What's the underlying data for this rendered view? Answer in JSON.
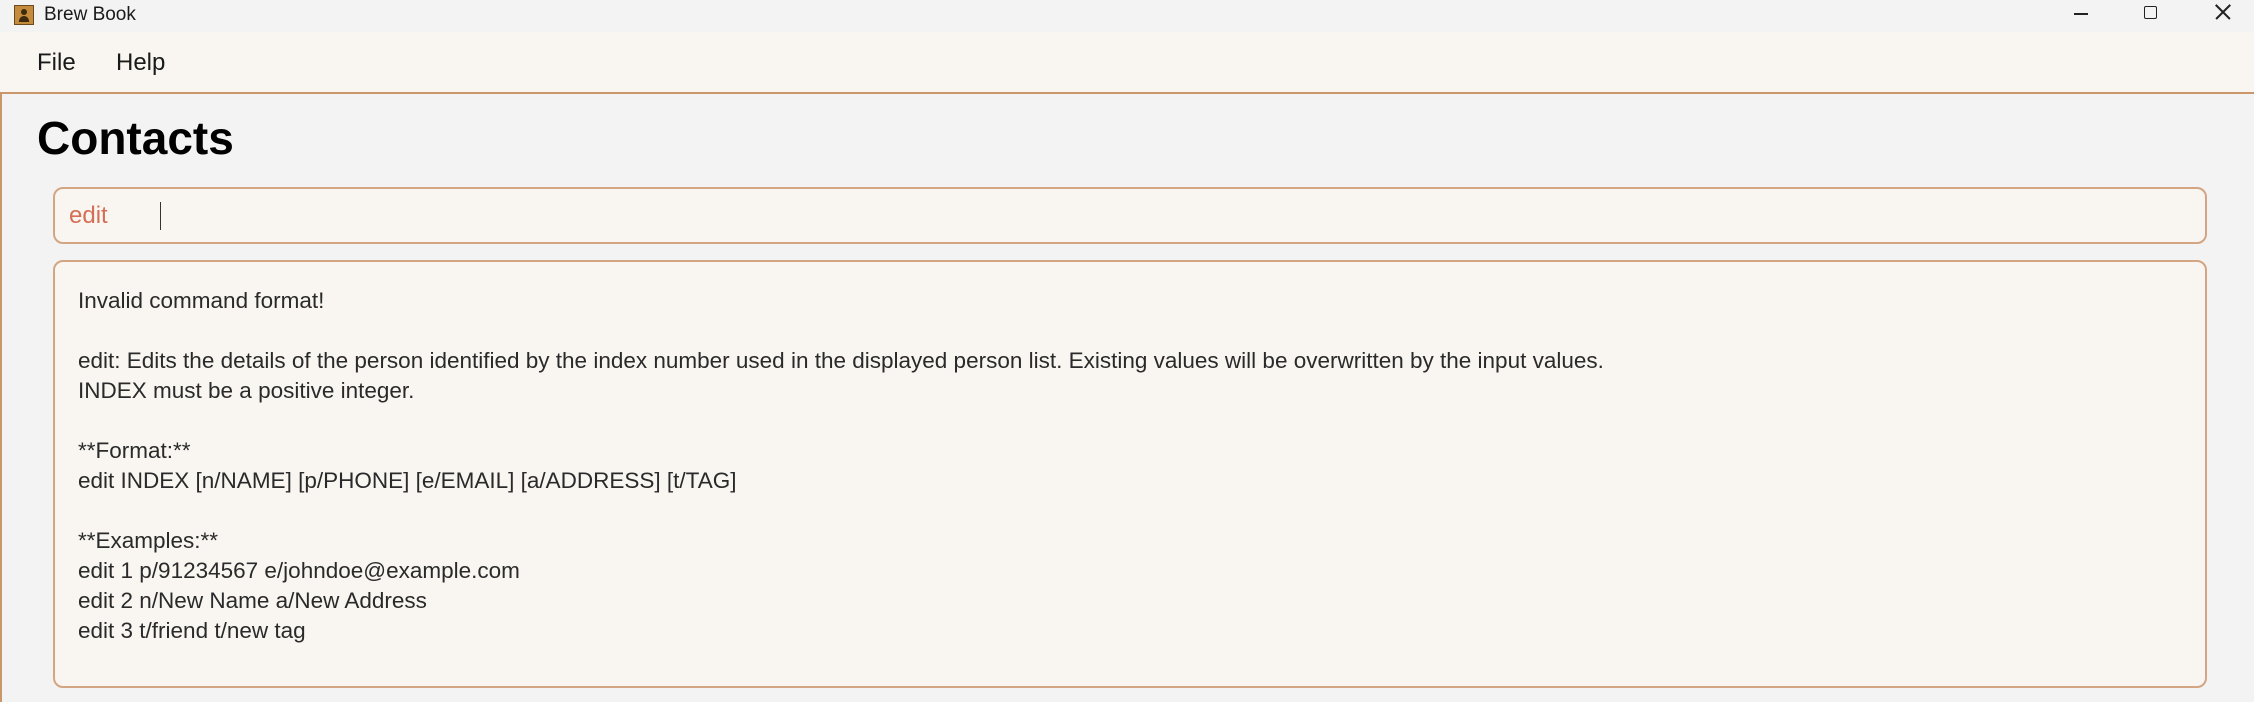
{
  "window": {
    "title": "Brew Book",
    "app_icon": "person-card-icon",
    "controls": [
      "minimize-icon",
      "maximize-icon",
      "close-icon"
    ]
  },
  "menubar": {
    "items": [
      {
        "label": "File"
      },
      {
        "label": "Help"
      }
    ]
  },
  "main": {
    "heading": "Contacts",
    "command": {
      "value": "edit",
      "placeholder": ""
    },
    "result": {
      "lines": [
        "Invalid command format!",
        "",
        "edit: Edits the details of the person identified by the index number used in the displayed person list. Existing values will be overwritten by the input values.",
        "INDEX must be a positive integer.",
        "",
        "**Format:**",
        "edit INDEX [n/NAME] [p/PHONE] [e/EMAIL] [a/ADDRESS] [t/TAG]",
        "",
        "**Examples:**",
        "edit 1 p/91234567 e/johndoe@example.com",
        "edit 2 n/New Name a/New Address",
        "edit 3 t/friend t/new tag"
      ]
    }
  },
  "colors": {
    "accent_border": "#d4a583",
    "menu_divider": "#c9976a",
    "panel_bg": "#f9f6f2",
    "window_bg": "#f3f3f3",
    "command_text": "#d46f55"
  }
}
